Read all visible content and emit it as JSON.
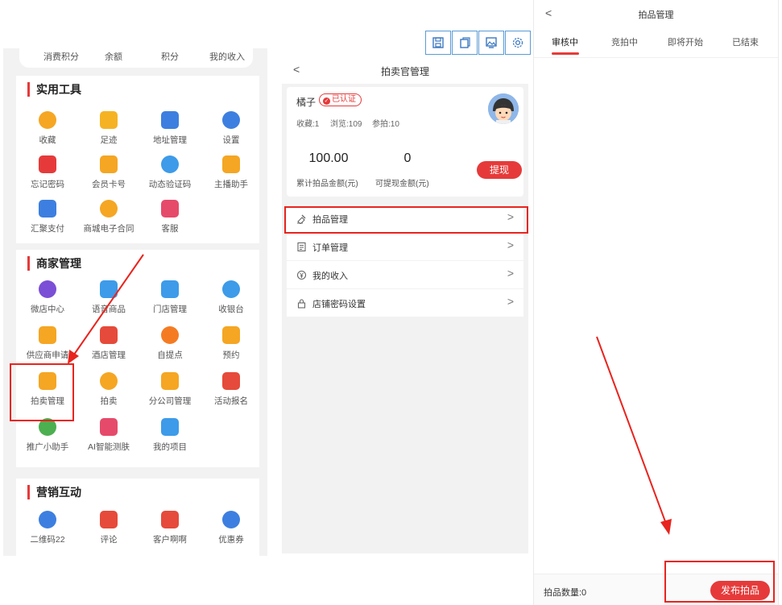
{
  "colors": {
    "accent": "#e63a3a",
    "highlight": "#e8241e",
    "toolbar_border": "#5a9bd5"
  },
  "profile_summary": {
    "items": [
      "消费积分",
      "余额",
      "积分",
      "我的收入"
    ]
  },
  "tools": {
    "title": "实用工具",
    "items": [
      {
        "label": "收藏",
        "icon": "star-icon",
        "color": "#f5a623"
      },
      {
        "label": "足迹",
        "icon": "footprint-icon",
        "color": "#f5b323"
      },
      {
        "label": "地址管理",
        "icon": "location-pin-icon",
        "color": "#3d7fe0"
      },
      {
        "label": "设置",
        "icon": "gear-icon",
        "color": "#3d7fe0"
      },
      {
        "label": "忘记密码",
        "icon": "lock-icon",
        "color": "#e63a3a"
      },
      {
        "label": "会员卡号",
        "icon": "card-icon",
        "color": "#f5a623"
      },
      {
        "label": "动态验证码",
        "icon": "code-card-icon",
        "color": "#3d9be9"
      },
      {
        "label": "主播助手",
        "icon": "anchor-user-icon",
        "color": "#f5a623"
      },
      {
        "label": "汇聚支付",
        "icon": "payment-icon",
        "color": "#3d7fe0"
      },
      {
        "label": "商城电子合同",
        "icon": "contract-icon",
        "color": "#f5a623"
      },
      {
        "label": "客服",
        "icon": "customer-service-icon",
        "color": "#e64a6a"
      }
    ]
  },
  "merchant": {
    "title": "商家管理",
    "items": [
      {
        "label": "微店中心",
        "icon": "shop-icon",
        "color": "#7b4fd6"
      },
      {
        "label": "语音商品",
        "icon": "microphone-icon",
        "color": "#3d9be9"
      },
      {
        "label": "门店管理",
        "icon": "store-icon",
        "color": "#3d9be9"
      },
      {
        "label": "收银台",
        "icon": "cashier-icon",
        "color": "#3d9be9"
      },
      {
        "label": "供应商申请",
        "icon": "supplier-icon",
        "color": "#f5a623"
      },
      {
        "label": "酒店管理",
        "icon": "hotel-icon",
        "color": "#e64a3a"
      },
      {
        "label": "自提点",
        "icon": "pickup-store-icon",
        "color": "#f57b23"
      },
      {
        "label": "预约",
        "icon": "alarm-clock-icon",
        "color": "#f5a623"
      },
      {
        "label": "拍卖管理",
        "icon": "auction-manage-icon",
        "color": "#f5a623"
      },
      {
        "label": "拍卖",
        "icon": "gavel-icon",
        "color": "#f5a623"
      },
      {
        "label": "分公司管理",
        "icon": "branch-icon",
        "color": "#f5a623"
      },
      {
        "label": "活动报名",
        "icon": "activity-icon",
        "color": "#e64a3a"
      },
      {
        "label": "推广小助手",
        "icon": "promo-helper-icon",
        "color": "#4caf50"
      },
      {
        "label": "AI智能测肤",
        "icon": "ai-skin-icon",
        "color": "#e64a6a"
      },
      {
        "label": "我的项目",
        "icon": "project-icon",
        "color": "#3d9be9"
      }
    ]
  },
  "marketing": {
    "title": "营销互动",
    "items": [
      {
        "label": "二维码22",
        "icon": "qrcode-icon",
        "color": "#3d7fe0"
      },
      {
        "label": "评论",
        "icon": "comment-icon",
        "color": "#e64a3a"
      },
      {
        "label": "客户啊啊",
        "icon": "customer-icon",
        "color": "#e64a3a"
      },
      {
        "label": "优惠券",
        "icon": "coupon-icon",
        "color": "#3d7fe0"
      }
    ]
  },
  "toolbar": {
    "items": [
      "save-icon",
      "copy-icon",
      "image-icon",
      "settings-icon"
    ]
  },
  "auctioneer": {
    "title": "拍卖官管理",
    "back": "<",
    "name": "橘子",
    "badge": "已认证",
    "stats": {
      "favorites": "收藏:1",
      "views": "浏览:109",
      "bids": "参拍:10"
    },
    "total_amount": "100.00",
    "total_label": "累计拍品金额(元)",
    "withdrawable_amount": "0",
    "withdrawable_label": "可提现金额(元)",
    "withdraw_button": "提现",
    "menu": [
      {
        "label": "拍品管理",
        "icon": "auction-item-icon"
      },
      {
        "label": "订单管理",
        "icon": "order-icon"
      },
      {
        "label": "我的收入",
        "icon": "income-icon"
      },
      {
        "label": "店铺密码设置",
        "icon": "lock-icon"
      }
    ],
    "chevron": ">"
  },
  "auction_items": {
    "title": "拍品管理",
    "back": "<",
    "tabs": [
      "审核中",
      "竞拍中",
      "即将开始",
      "已结束"
    ],
    "active_tab": 0,
    "count_label": "拍品数量:0",
    "publish_button": "发布拍品"
  }
}
